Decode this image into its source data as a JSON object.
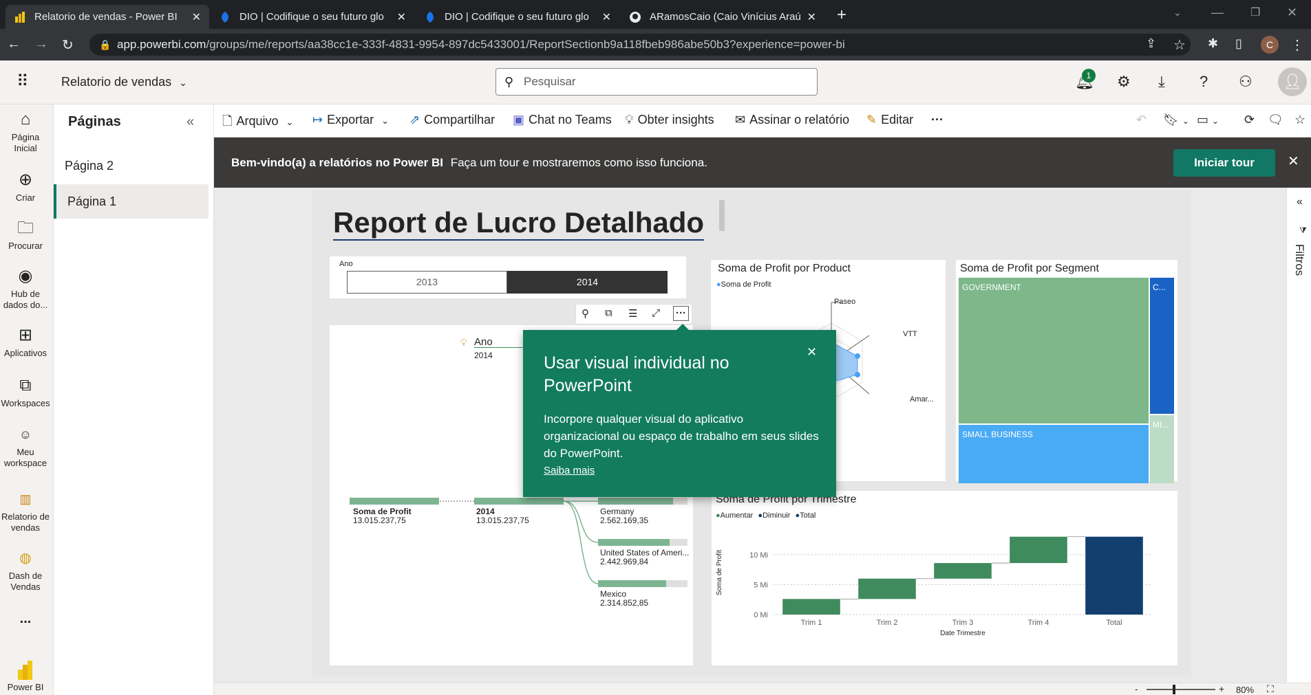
{
  "browser": {
    "tabs": [
      {
        "title": "Relatorio de vendas - Power BI",
        "active": true
      },
      {
        "title": "DIO | Codifique o seu futuro glo",
        "active": false
      },
      {
        "title": "DIO | Codifique o seu futuro glo",
        "active": false
      },
      {
        "title": "ARamosCaio (Caio Vinícius Araú",
        "active": false
      }
    ],
    "url_host": "app.powerbi.com",
    "url_path": "/groups/me/reports/aa38cc1e-333f-4831-9954-897dc5433001/ReportSectionb9a118fbeb986abe50b3?experience=power-bi",
    "profile_initial": "C"
  },
  "header": {
    "report_name": "Relatorio de vendas",
    "search_placeholder": "Pesquisar",
    "notification_count": "1"
  },
  "leftnav": {
    "items": [
      {
        "label": "Página Inicial",
        "icon": "home-icon"
      },
      {
        "label": "Criar",
        "icon": "create-icon"
      },
      {
        "label": "Procurar",
        "icon": "browse-icon"
      },
      {
        "label": "Hub de dados do...",
        "icon": "datahub-icon"
      },
      {
        "label": "Aplicativos",
        "icon": "apps-icon"
      },
      {
        "label": "Workspaces",
        "icon": "workspaces-icon"
      },
      {
        "label": "Meu workspace",
        "icon": "my-workspace-icon"
      },
      {
        "label": "Relatorio de vendas",
        "icon": "report-icon"
      },
      {
        "label": "Dash de Vendas",
        "icon": "dashboard-icon"
      },
      {
        "label": "...",
        "icon": "more-icon"
      },
      {
        "label": "Power BI",
        "icon": "powerbi-icon"
      }
    ]
  },
  "pages": {
    "title": "Páginas",
    "items": [
      {
        "label": "Página 2",
        "selected": false
      },
      {
        "label": "Página 1",
        "selected": true
      }
    ]
  },
  "toolbar": {
    "arquivo": "Arquivo",
    "exportar": "Exportar",
    "compartilhar": "Compartilhar",
    "teams": "Chat no Teams",
    "insights": "Obter insights",
    "assinar": "Assinar o relatório",
    "editar": "Editar",
    "more": "···"
  },
  "banner": {
    "bold": "Bem-vindo(a) a relatórios no Power BI",
    "text": "Faça um tour e mostraremos como isso funciona.",
    "button": "Iniciar tour"
  },
  "report": {
    "title": "Report de Lucro Detalhado",
    "slicer": {
      "label": "Ano",
      "options": [
        "2013",
        "2014"
      ],
      "selected": "2014"
    },
    "decomp": {
      "hint_label": "Ano",
      "hint_value": "2014",
      "root_label": "Soma de Profit",
      "root_value": "13.015.237,75",
      "level1_label": "2014",
      "level1_value": "13.015.237,75",
      "children": [
        {
          "label": "Germany",
          "value": "2.562.169,35",
          "fraction": 0.84
        },
        {
          "label": "United States of Ameri...",
          "value": "2.442.969,84",
          "fraction": 0.8
        },
        {
          "label": "Mexico",
          "value": "2.314.852,85",
          "fraction": 0.76
        }
      ]
    },
    "radar": {
      "title": "Soma de Profit por Product",
      "legend": "Soma de Profit",
      "labels": [
        "Paseo",
        "VTT",
        "Amar..."
      ]
    },
    "treemap": {
      "title": "Soma de Profit por Segment",
      "cells": [
        "GOVERNMENT",
        "SMALL BUSINESS",
        "C...",
        "MI..."
      ]
    },
    "filters_label": "Filtros",
    "zoom": "80%"
  },
  "popup": {
    "title": "Usar visual individual no PowerPoint",
    "body": "Incorpore qualquer visual do aplicativo organizacional ou espaço de trabalho em seus slides do PowerPoint.",
    "link": "Saiba mais"
  },
  "chart_data": {
    "type": "bar",
    "title": "Soma de Profit por Trimestre",
    "xlabel": "Date Trimestre",
    "ylabel": "Soma de Profit",
    "categories": [
      "Trim 1",
      "Trim 2",
      "Trim 3",
      "Trim 4",
      "Total"
    ],
    "waterfall_start": [
      0,
      2.6,
      6.0,
      8.6,
      0
    ],
    "values": [
      2.6,
      3.4,
      2.6,
      4.4,
      13.0
    ],
    "kinds": [
      "Aumentar",
      "Aumentar",
      "Aumentar",
      "Aumentar",
      "Total"
    ],
    "legend": [
      "Aumentar",
      "Diminuir",
      "Total"
    ],
    "yticks": [
      "0 Mi",
      "5 Mi",
      "10 Mi"
    ],
    "ylim": [
      0,
      14
    ],
    "colors": {
      "Aumentar": "#3f8b5d",
      "Diminuir": "#12375f",
      "Total": "#123f6e"
    }
  }
}
